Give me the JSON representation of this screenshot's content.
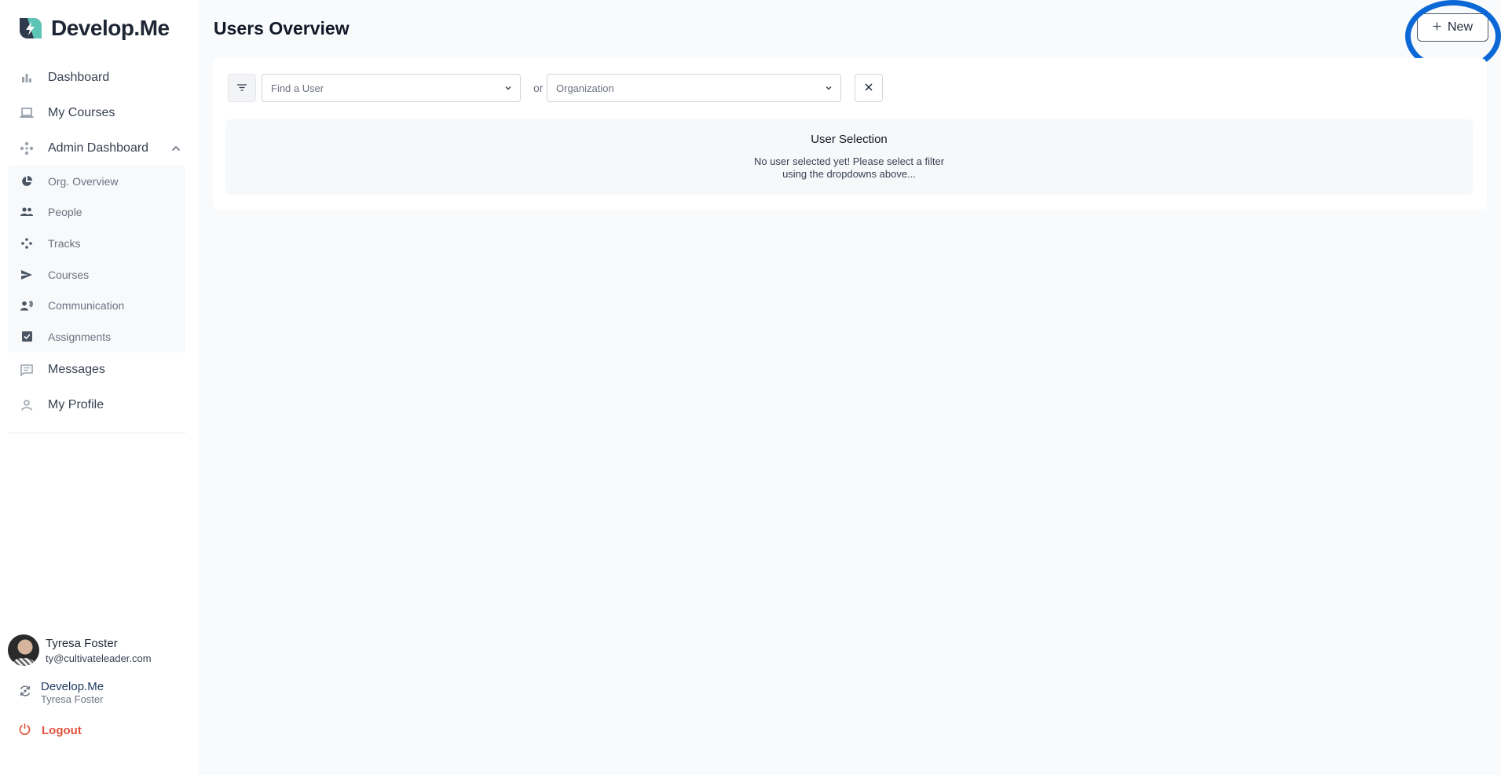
{
  "brand": {
    "name": "Develop.Me"
  },
  "sidebar": {
    "items": [
      {
        "label": "Dashboard",
        "icon": "bar-chart-icon"
      },
      {
        "label": "My Courses",
        "icon": "laptop-icon"
      },
      {
        "label": "Admin Dashboard",
        "icon": "admin-icon",
        "expanded": true
      }
    ],
    "sub_items": [
      {
        "label": "Org. Overview",
        "icon": "pie-chart-icon"
      },
      {
        "label": "People",
        "icon": "people-icon"
      },
      {
        "label": "Tracks",
        "icon": "tracks-icon"
      },
      {
        "label": "Courses",
        "icon": "send-icon"
      },
      {
        "label": "Communication",
        "icon": "communication-icon"
      },
      {
        "label": "Assignments",
        "icon": "checkbox-icon"
      }
    ],
    "bottom_items": [
      {
        "label": "Messages",
        "icon": "message-icon"
      },
      {
        "label": "My Profile",
        "icon": "person-icon"
      }
    ]
  },
  "user": {
    "name": "Tyresa Foster",
    "email": "ty@cultivateleader.com"
  },
  "org": {
    "name": "Develop.Me",
    "user": "Tyresa Foster"
  },
  "logout_label": "Logout",
  "header": {
    "title": "Users Overview",
    "new_label": "New"
  },
  "filters": {
    "user_placeholder": "Find a User",
    "or_label": "or",
    "org_placeholder": "Organization"
  },
  "empty_state": {
    "title": "User Selection",
    "message": "No user selected yet! Please select a filter using the dropdowns above..."
  },
  "colors": {
    "accent_ring": "#0b68d6",
    "logout": "#e0533d",
    "brand_teal": "#5ec4b6"
  }
}
